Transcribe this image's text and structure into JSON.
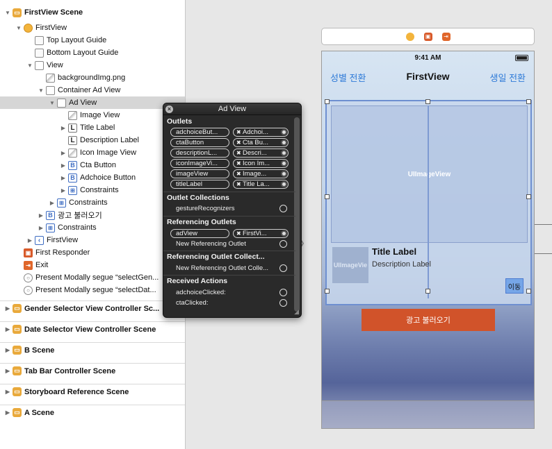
{
  "outline": {
    "rows": [
      {
        "label": "FirstView Scene"
      },
      {
        "label": "FirstView"
      },
      {
        "label": "Top Layout Guide"
      },
      {
        "label": "Bottom Layout Guide"
      },
      {
        "label": "View"
      },
      {
        "label": "backgroundImg.png"
      },
      {
        "label": "Container Ad View"
      },
      {
        "label": "Ad View"
      },
      {
        "label": "Image View"
      },
      {
        "label": "Title Label"
      },
      {
        "label": "Description Label"
      },
      {
        "label": "Icon Image View"
      },
      {
        "label": "Cta Button"
      },
      {
        "label": "Adchoice Button"
      },
      {
        "label": "Constraints"
      },
      {
        "label": "Constraints"
      },
      {
        "label": "광고 불러오기"
      },
      {
        "label": "Constraints"
      },
      {
        "label": "FirstView"
      },
      {
        "label": "First Responder"
      },
      {
        "label": "Exit"
      },
      {
        "label": "Present Modally segue “selectGen..."
      },
      {
        "label": "Present Modally segue “selectDat..."
      },
      {
        "label": "Gender Selector View Controller Sc..."
      },
      {
        "label": "Date Selector View Controller Scene"
      },
      {
        "label": "B Scene"
      },
      {
        "label": "Tab Bar Controller Scene"
      },
      {
        "label": "Storyboard Reference Scene"
      },
      {
        "label": "A Scene"
      }
    ]
  },
  "device": {
    "time": "9:41 AM",
    "nav_left": "성별 전환",
    "nav_title": "FirstView",
    "nav_right": "생일 전환",
    "adimage_placeholder": "UIImageView",
    "icon_placeholder": "UIImageVie",
    "title_label": "Title Label",
    "description_label": "Description Label",
    "cta_label": "이동",
    "load_ad_button": "광고 불러오기"
  },
  "popover": {
    "title": "Ad View",
    "sections": {
      "outlets": "Outlets",
      "collections": "Outlet Collections",
      "referencing": "Referencing Outlets",
      "ref_collections": "Referencing Outlet Collect...",
      "actions": "Received Actions"
    },
    "outlets": [
      {
        "name": "adchoiceBut...",
        "target": "Adchoi..."
      },
      {
        "name": "ctaButton",
        "target": "Cta Bu..."
      },
      {
        "name": "descriptionL...",
        "target": "Descri..."
      },
      {
        "name": "iconImageVi...",
        "target": "Icon Im..."
      },
      {
        "name": "imageView",
        "target": "Image..."
      },
      {
        "name": "titleLabel",
        "target": "Title La..."
      }
    ],
    "collections": [
      "gestureRecognizers"
    ],
    "referencing": [
      {
        "name": "adView",
        "target": "FirstVi..."
      }
    ],
    "new_referencing": "New Referencing Outlet",
    "new_ref_collection": "New Referencing Outlet Colle...",
    "actions": [
      "adchoiceClicked:",
      "ctaClicked:"
    ]
  }
}
